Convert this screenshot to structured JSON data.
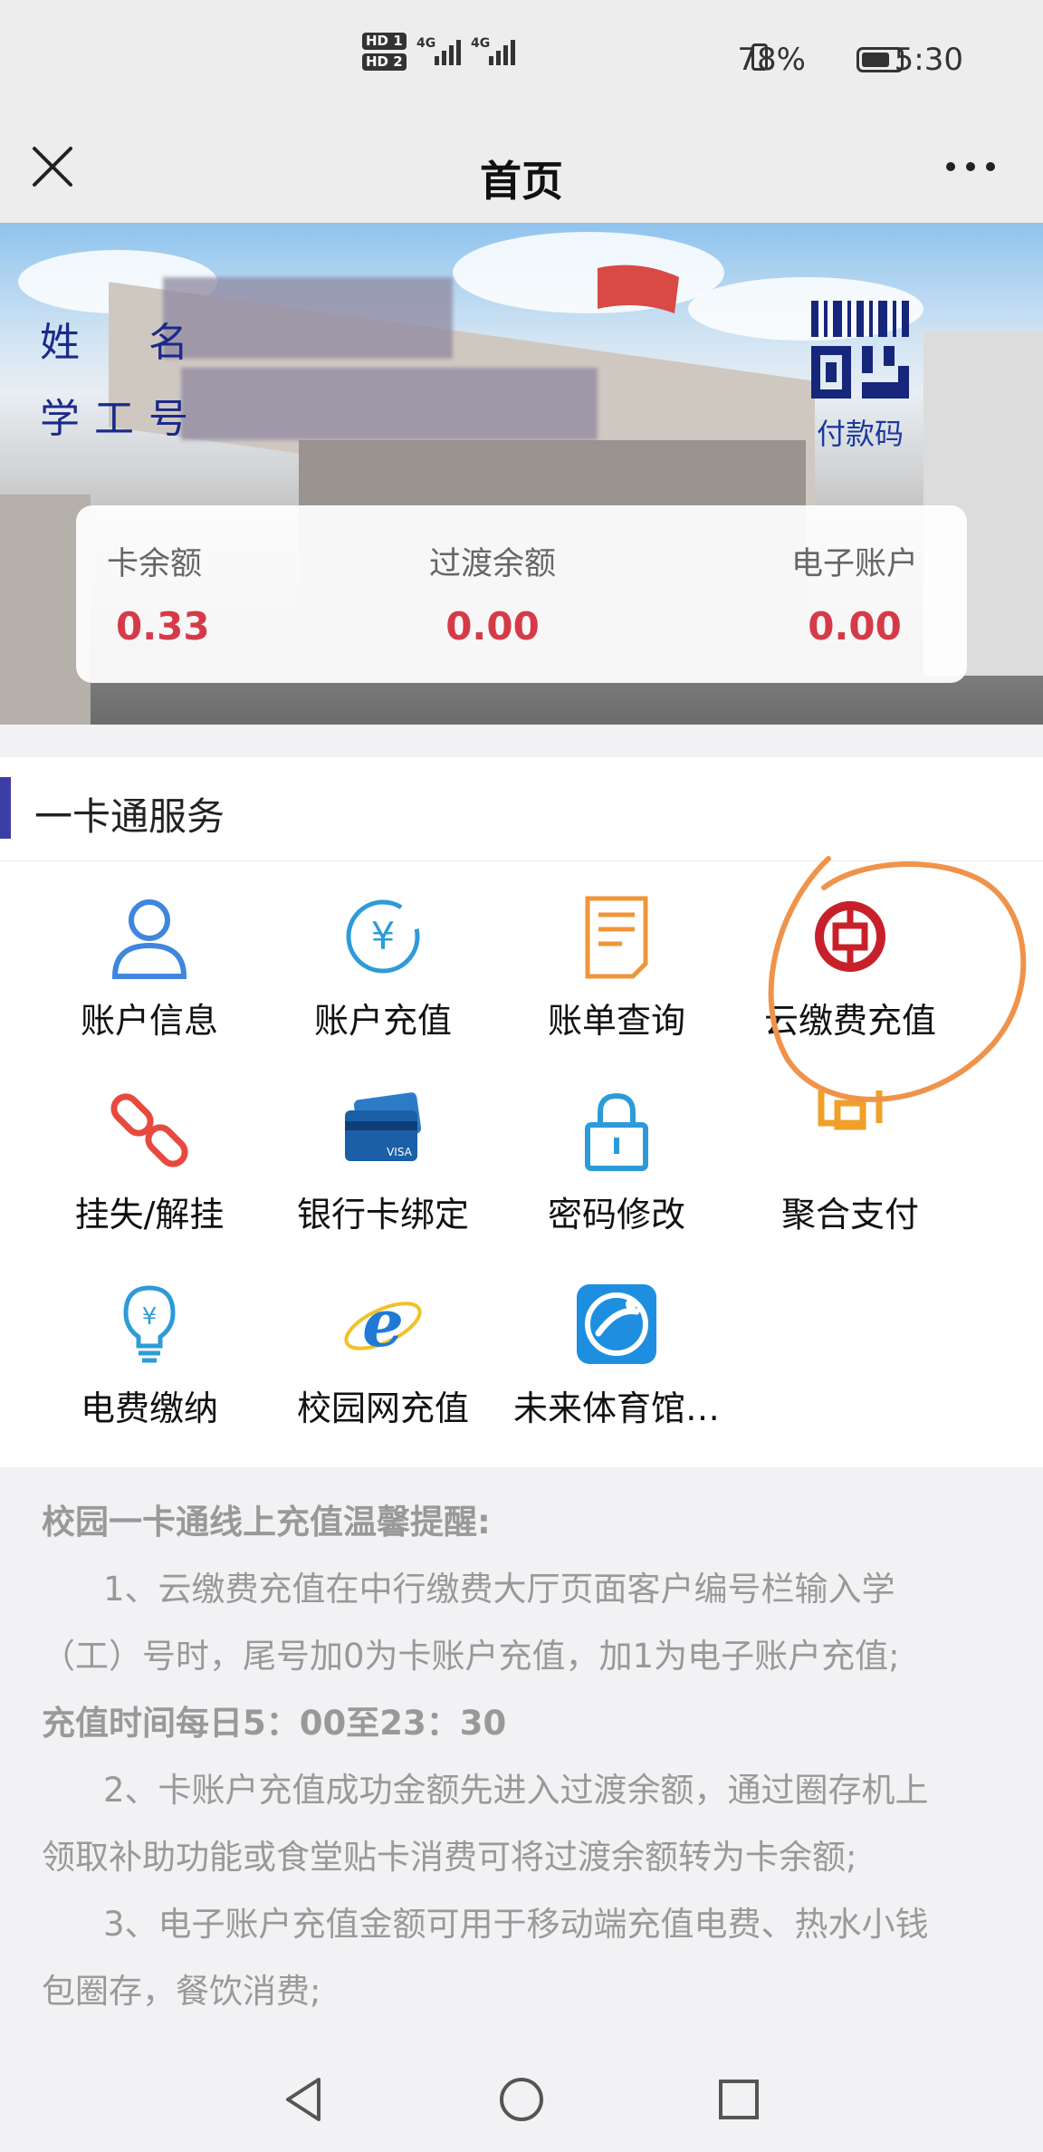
{
  "status_bar": {
    "sim1": "HD 1",
    "sim2": "HD 2",
    "net1": "4G",
    "net2": "4G",
    "battery": "78%",
    "time": "5:30"
  },
  "nav": {
    "title": "首页"
  },
  "banner": {
    "name_label": "姓　名",
    "id_label": "学工号",
    "paycode_label": "付款码"
  },
  "balances": [
    {
      "label": "卡余额",
      "value": "0.33"
    },
    {
      "label": "过渡余额",
      "value": "0.00"
    },
    {
      "label": "电子账户",
      "value": "0.00"
    }
  ],
  "service": {
    "title": "一卡通服务",
    "items": [
      {
        "label": "账户信息",
        "icon": "user-icon"
      },
      {
        "label": "账户充值",
        "icon": "yen-circle-icon"
      },
      {
        "label": "账单查询",
        "icon": "bill-icon"
      },
      {
        "label": "云缴费充值",
        "icon": "bank-of-china-icon"
      },
      {
        "label": "挂失/解挂",
        "icon": "chain-link-icon"
      },
      {
        "label": "银行卡绑定",
        "icon": "bank-card-icon"
      },
      {
        "label": "密码修改",
        "icon": "lock-icon"
      },
      {
        "label": "聚合支付",
        "icon": "aggregate-pay-icon"
      },
      {
        "label": "电费缴纳",
        "icon": "lightbulb-icon"
      },
      {
        "label": "校园网充值",
        "icon": "ie-browser-icon"
      },
      {
        "label": "未来体育馆…",
        "icon": "sports-app-icon"
      }
    ]
  },
  "tips": {
    "title": "校园一卡通线上充值温馨提醒:",
    "line1": "1、云缴费充值在中行缴费大厅页面客户编号栏输入学",
    "line2": "（工）号时，尾号加0为卡账户充值，加1为电子账户充值;",
    "line3": "充值时间每日5：00至23：30",
    "line4": "2、卡账户充值成功金额先进入过渡余额，通过圈存机上",
    "line5": "领取补助功能或食堂贴卡消费可将过渡余额转为卡余额;",
    "line6": "3、电子账户充值金额可用于移动端充值电费、热水小钱",
    "line7": "包圈存，餐饮消费;"
  },
  "colors": {
    "accent": "#3d3da8",
    "balance": "#d63a48",
    "annotation": "#f0934a"
  }
}
